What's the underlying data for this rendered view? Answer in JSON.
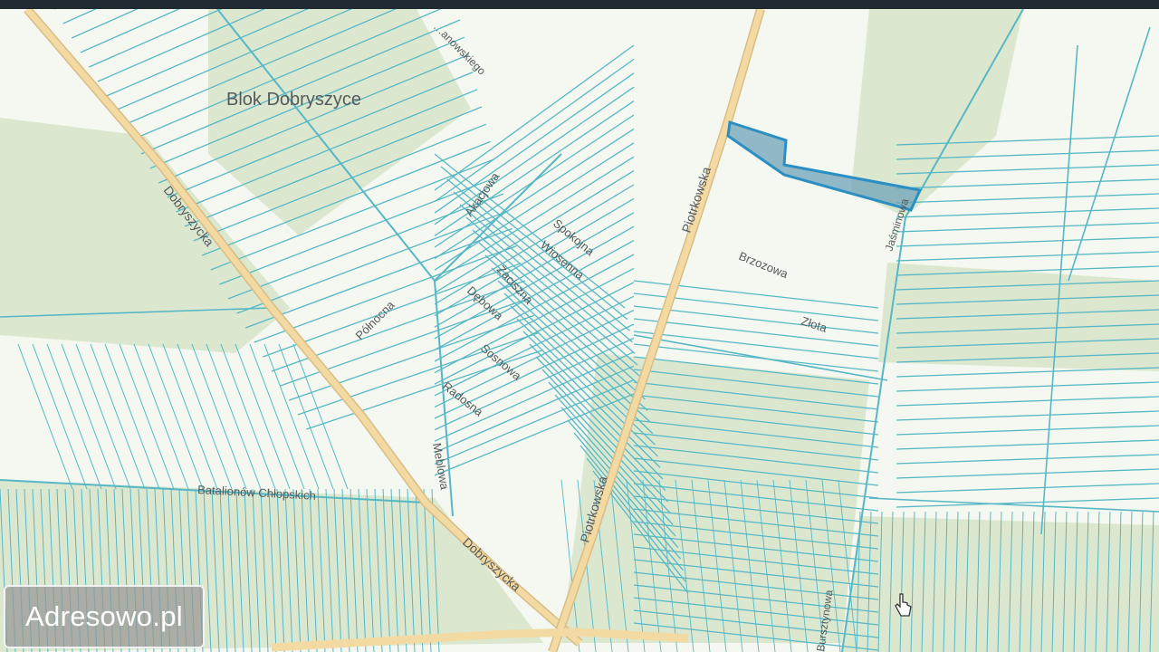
{
  "brand": {
    "watermark": "Adresowo.pl"
  },
  "map": {
    "area_label": "Blok Dobryszyce",
    "streets": {
      "dobryszycka_upper": "Dobryszycka",
      "dobryszycka_lower": "Dobryszycka",
      "piotrkowska_upper": "Piotrkowska",
      "piotrkowska_lower": "Piotrkowska",
      "akacjowa": "Akacjowa",
      "spokojna": "Spokojna",
      "wiosenna": "Wiosenna",
      "zaciszna": "Zaciszna",
      "debowa": "Dębowa",
      "sosnowa": "Sosnowa",
      "radosna": "Radosna",
      "polnocna": "Północna",
      "meblowa": "Meblowa",
      "batalionow": "Batalionów Chłopskich",
      "brzozowa": "Brzozowa",
      "zlota": "Złota",
      "jasminowa": "Jaśminowa",
      "partial_top": "…anowskiego",
      "partial_bottom_right": "Bursztynowa"
    },
    "colors": {
      "parcel_line": "#57b7c5",
      "road": "#f3d9a2",
      "road_edge": "#d9bd86",
      "base": "#f4f8f0",
      "field": "#dbe8cf",
      "highlight_fill": "#6fa3b8",
      "highlight_stroke": "#2b8fc4"
    },
    "icons": {
      "cursor": "hand-cursor-icon"
    }
  }
}
